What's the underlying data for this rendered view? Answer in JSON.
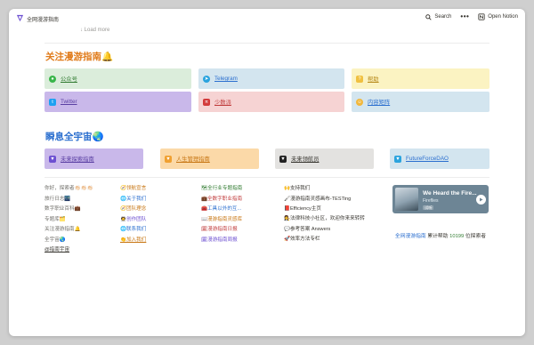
{
  "topbar": {
    "workspace_title": "全网漫游指南",
    "search_label": "Search",
    "more_label": "•••",
    "open_notion_label": "Open Notion"
  },
  "load_more": "↓ Load more",
  "section1": {
    "title": "关注漫游指南🔔",
    "buttons": [
      {
        "label": "公众号",
        "icon": "wechat-icon"
      },
      {
        "label": "Telegram",
        "icon": "telegram-icon"
      },
      {
        "label": "帮助",
        "icon": "help-icon"
      },
      {
        "label": "Twitter",
        "icon": "twitter-icon"
      },
      {
        "label": "少数派",
        "icon": "sspai-icon"
      },
      {
        "label": "内容矩阵",
        "icon": "matrix-icon"
      }
    ]
  },
  "section2": {
    "title": "瞬息全宇宙🌏",
    "buttons": [
      {
        "label": "未来探索指南",
        "icon": "v-logo-icon"
      },
      {
        "label": "人生管理指南",
        "icon": "v-logo-icon"
      },
      {
        "label": "未来领航员",
        "icon": "v-logo-icon"
      },
      {
        "label": "FutureForceDAO",
        "icon": "v-logo-icon"
      }
    ]
  },
  "col1": [
    "你好，探索者👏🏻👏🏻👏🏻",
    "旅行日志🌃",
    "数字职业百科💼",
    "专题库🗂️",
    "关注漫游指南🔔",
    "全宇宙🌏",
    "@指南宇宙"
  ],
  "col2": [
    "🧭领航宣言",
    "🌐关于我们",
    "🧭团队理念",
    "🧑‍🚀创作团队",
    "🌐联系我们",
    "👏加入我们"
  ],
  "col3": [
    "🗺全行业专题指南",
    "💼全数字职业指南",
    "🧰工具以外的互...",
    "📖漫游指南灵感库",
    "🗓漫游指南日报",
    "🗓漫游指南周报"
  ],
  "col4": [
    "🙌支持我们",
    "🖌漫游指南灵感画布-TESTing",
    "📕Efficiency主页",
    "👩‍⚖️法律科技小社区，欢迎你来来转转",
    "💬参考答案 Answers",
    "🚀效率方法专栏"
  ],
  "player": {
    "title": "We Heard the Fire...",
    "artist": "Fireflies",
    "tag": "试听"
  },
  "stat": {
    "brand": "全网漫游指南",
    "text_before": " 累计帮助 ",
    "count": "10199",
    "text_after": " 位探索者"
  },
  "colors": {
    "orange_heading": "#e07b1a",
    "blue_heading": "#2b6fcf"
  }
}
